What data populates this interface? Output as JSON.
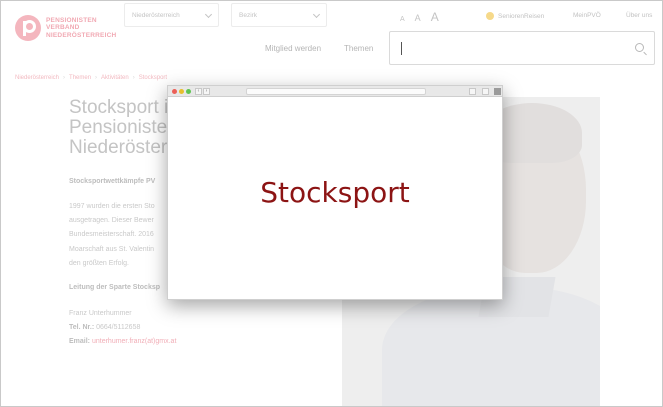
{
  "header": {
    "logo_lines": [
      "PENSIONISTEN",
      "VERBAND",
      "NIEDERÖSTERREICH"
    ],
    "region_select": "Niederösterreich",
    "bezirk_select": "Bezirk",
    "font_sizes": [
      "A",
      "A",
      "A"
    ],
    "links": {
      "reisen": "SeniorenReisen",
      "pvoe": "MeinPVÖ",
      "ueber": "Über uns"
    },
    "nav": {
      "mitglied": "Mitglied werden",
      "themen": "Themen"
    },
    "search": {
      "value": ""
    }
  },
  "breadcrumb": [
    "Niederösterreich",
    "Themen",
    "Aktivitäten",
    "Stocksport"
  ],
  "content": {
    "title_lines": [
      "Stocksport i",
      "Pensioniste",
      "Niederöster"
    ],
    "subhead": "Stocksportwettkämpfe PV",
    "para_lines": [
      "1997 wurden die ersten Sto",
      "ausgetragen. Dieser Bewer",
      "Bundesmeisterschaft. 2016",
      "Moarschaft aus St. Valentin",
      "den größten Erfolg."
    ],
    "leitung": "Leitung der Sparte Stocksp",
    "contact": {
      "name": "Franz Unterhummer",
      "tel_label": "Tel. Nr.:",
      "tel": "0664/5112658",
      "email_label": "Email:",
      "email": "unterhumer.franz(at)gmx.at"
    }
  },
  "popup": {
    "title": "Stocksport",
    "title_color": "#8c1414"
  },
  "colors": {
    "brand": "#e7354d"
  }
}
